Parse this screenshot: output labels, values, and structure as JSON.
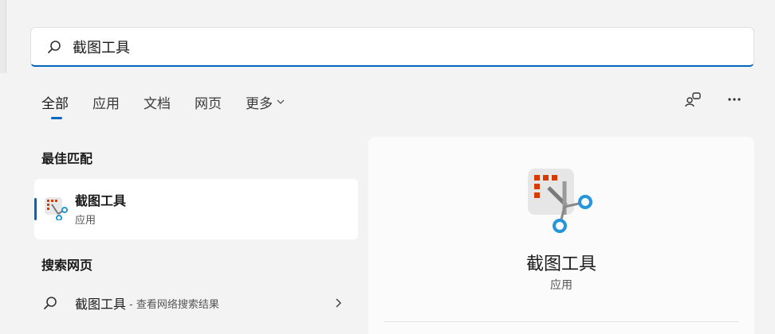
{
  "search": {
    "value": "截图工具",
    "placeholder": ""
  },
  "tabs": [
    {
      "label": "全部",
      "active": true
    },
    {
      "label": "应用"
    },
    {
      "label": "文档"
    },
    {
      "label": "网页"
    },
    {
      "label": "更多"
    }
  ],
  "sections": {
    "best_match": "最佳匹配",
    "search_web": "搜索网页"
  },
  "best_match": {
    "name": "截图工具",
    "type": "应用"
  },
  "web_result": {
    "query": "截图工具",
    "hint": "- 查看网络搜索结果"
  },
  "detail": {
    "name": "截图工具",
    "type": "应用"
  },
  "colors": {
    "accent": "#0067c0",
    "snip_red": "#d83b01",
    "snip_blue": "#2596d9"
  },
  "icons": {
    "search": "search-icon",
    "more_chevron": "chevron-down-icon",
    "account": "account-switch-icon",
    "menu": "more-icon",
    "app": "snipping-tool-icon",
    "row_chevron": "chevron-right-icon"
  }
}
